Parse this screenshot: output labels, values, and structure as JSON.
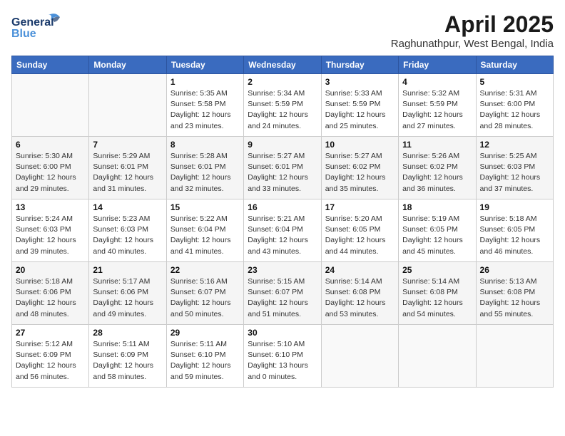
{
  "header": {
    "logo_line1": "General",
    "logo_line2": "Blue",
    "month_year": "April 2025",
    "location": "Raghunathpur, West Bengal, India"
  },
  "days_of_week": [
    "Sunday",
    "Monday",
    "Tuesday",
    "Wednesday",
    "Thursday",
    "Friday",
    "Saturday"
  ],
  "weeks": [
    [
      {
        "day": "",
        "info": ""
      },
      {
        "day": "",
        "info": ""
      },
      {
        "day": "1",
        "info": "Sunrise: 5:35 AM\nSunset: 5:58 PM\nDaylight: 12 hours\nand 23 minutes."
      },
      {
        "day": "2",
        "info": "Sunrise: 5:34 AM\nSunset: 5:59 PM\nDaylight: 12 hours\nand 24 minutes."
      },
      {
        "day": "3",
        "info": "Sunrise: 5:33 AM\nSunset: 5:59 PM\nDaylight: 12 hours\nand 25 minutes."
      },
      {
        "day": "4",
        "info": "Sunrise: 5:32 AM\nSunset: 5:59 PM\nDaylight: 12 hours\nand 27 minutes."
      },
      {
        "day": "5",
        "info": "Sunrise: 5:31 AM\nSunset: 6:00 PM\nDaylight: 12 hours\nand 28 minutes."
      }
    ],
    [
      {
        "day": "6",
        "info": "Sunrise: 5:30 AM\nSunset: 6:00 PM\nDaylight: 12 hours\nand 29 minutes."
      },
      {
        "day": "7",
        "info": "Sunrise: 5:29 AM\nSunset: 6:01 PM\nDaylight: 12 hours\nand 31 minutes."
      },
      {
        "day": "8",
        "info": "Sunrise: 5:28 AM\nSunset: 6:01 PM\nDaylight: 12 hours\nand 32 minutes."
      },
      {
        "day": "9",
        "info": "Sunrise: 5:27 AM\nSunset: 6:01 PM\nDaylight: 12 hours\nand 33 minutes."
      },
      {
        "day": "10",
        "info": "Sunrise: 5:27 AM\nSunset: 6:02 PM\nDaylight: 12 hours\nand 35 minutes."
      },
      {
        "day": "11",
        "info": "Sunrise: 5:26 AM\nSunset: 6:02 PM\nDaylight: 12 hours\nand 36 minutes."
      },
      {
        "day": "12",
        "info": "Sunrise: 5:25 AM\nSunset: 6:03 PM\nDaylight: 12 hours\nand 37 minutes."
      }
    ],
    [
      {
        "day": "13",
        "info": "Sunrise: 5:24 AM\nSunset: 6:03 PM\nDaylight: 12 hours\nand 39 minutes."
      },
      {
        "day": "14",
        "info": "Sunrise: 5:23 AM\nSunset: 6:03 PM\nDaylight: 12 hours\nand 40 minutes."
      },
      {
        "day": "15",
        "info": "Sunrise: 5:22 AM\nSunset: 6:04 PM\nDaylight: 12 hours\nand 41 minutes."
      },
      {
        "day": "16",
        "info": "Sunrise: 5:21 AM\nSunset: 6:04 PM\nDaylight: 12 hours\nand 43 minutes."
      },
      {
        "day": "17",
        "info": "Sunrise: 5:20 AM\nSunset: 6:05 PM\nDaylight: 12 hours\nand 44 minutes."
      },
      {
        "day": "18",
        "info": "Sunrise: 5:19 AM\nSunset: 6:05 PM\nDaylight: 12 hours\nand 45 minutes."
      },
      {
        "day": "19",
        "info": "Sunrise: 5:18 AM\nSunset: 6:05 PM\nDaylight: 12 hours\nand 46 minutes."
      }
    ],
    [
      {
        "day": "20",
        "info": "Sunrise: 5:18 AM\nSunset: 6:06 PM\nDaylight: 12 hours\nand 48 minutes."
      },
      {
        "day": "21",
        "info": "Sunrise: 5:17 AM\nSunset: 6:06 PM\nDaylight: 12 hours\nand 49 minutes."
      },
      {
        "day": "22",
        "info": "Sunrise: 5:16 AM\nSunset: 6:07 PM\nDaylight: 12 hours\nand 50 minutes."
      },
      {
        "day": "23",
        "info": "Sunrise: 5:15 AM\nSunset: 6:07 PM\nDaylight: 12 hours\nand 51 minutes."
      },
      {
        "day": "24",
        "info": "Sunrise: 5:14 AM\nSunset: 6:08 PM\nDaylight: 12 hours\nand 53 minutes."
      },
      {
        "day": "25",
        "info": "Sunrise: 5:14 AM\nSunset: 6:08 PM\nDaylight: 12 hours\nand 54 minutes."
      },
      {
        "day": "26",
        "info": "Sunrise: 5:13 AM\nSunset: 6:08 PM\nDaylight: 12 hours\nand 55 minutes."
      }
    ],
    [
      {
        "day": "27",
        "info": "Sunrise: 5:12 AM\nSunset: 6:09 PM\nDaylight: 12 hours\nand 56 minutes."
      },
      {
        "day": "28",
        "info": "Sunrise: 5:11 AM\nSunset: 6:09 PM\nDaylight: 12 hours\nand 58 minutes."
      },
      {
        "day": "29",
        "info": "Sunrise: 5:11 AM\nSunset: 6:10 PM\nDaylight: 12 hours\nand 59 minutes."
      },
      {
        "day": "30",
        "info": "Sunrise: 5:10 AM\nSunset: 6:10 PM\nDaylight: 13 hours\nand 0 minutes."
      },
      {
        "day": "",
        "info": ""
      },
      {
        "day": "",
        "info": ""
      },
      {
        "day": "",
        "info": ""
      }
    ]
  ]
}
